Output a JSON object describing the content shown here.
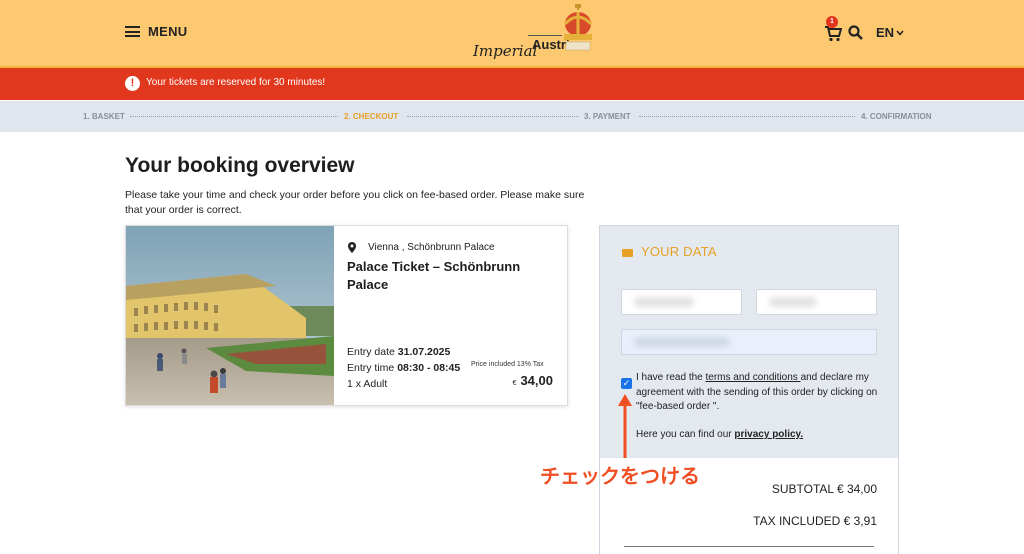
{
  "header": {
    "menu_label": "MENU",
    "logo_word_1": "Imperial",
    "logo_word_2": "Austria",
    "cart_count": "1",
    "language": "EN"
  },
  "banner": {
    "icon": "!",
    "text": "Your tickets are reserved for 30 minutes!"
  },
  "steps": [
    {
      "label": "1. BASKET",
      "active": false
    },
    {
      "label": "2. CHECKOUT",
      "active": true
    },
    {
      "label": "3. PAYMENT",
      "active": false
    },
    {
      "label": "4. CONFIRMATION",
      "active": false
    }
  ],
  "main": {
    "title": "Your booking overview",
    "intro": "Please take your time and check your order before you click on fee-based order. Please make sure that your order is correct."
  },
  "booking": {
    "location": "Vienna , Schönbrunn Palace",
    "ticket_title": "Palace Ticket – Schönbrunn Palace",
    "entry_date_label": "Entry date",
    "entry_date_value": "31.07.2025",
    "entry_time_label": "Entry time",
    "entry_time_value": "08:30 - 08:45",
    "tax_note": "Price included 13% Tax",
    "quantity": "1 x Adult",
    "currency": "€",
    "price": "34,00"
  },
  "your_data": {
    "title": "YOUR DATA",
    "consent_prefix": "I have read the ",
    "consent_link": "terms and conditions ",
    "consent_suffix": "and declare my agreement with the sending of this order by clicking on \"fee-based order \".",
    "consent_checked": true,
    "privacy_prefix": "Here you can find our ",
    "privacy_link": "privacy policy.",
    "subtotal": "SUBTOTAL € 34,00",
    "tax_included": "TAX INCLUDED € 3,91"
  },
  "annotation": {
    "text": "チェックをつける",
    "color": "#f04e23"
  },
  "colors": {
    "header_bg": "#fcc870",
    "banner_bg": "#e0371d",
    "accent": "#e6a126",
    "steps_bg": "#e0e5ee"
  }
}
